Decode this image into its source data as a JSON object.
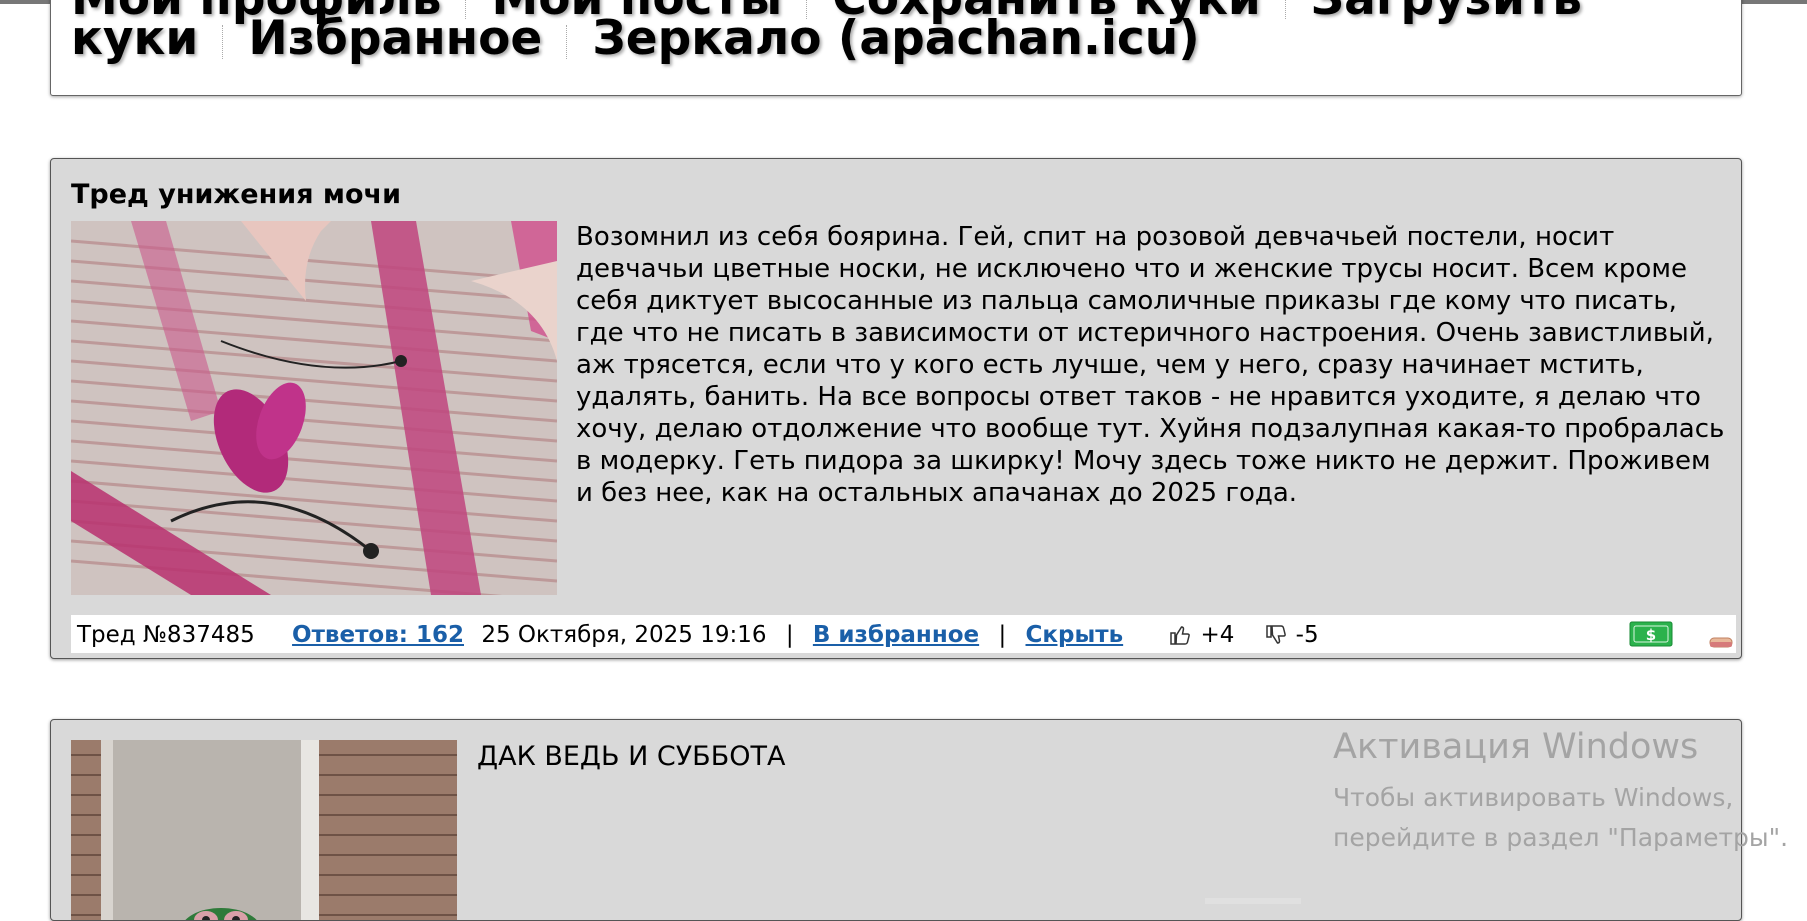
{
  "nav": {
    "row1": [
      "Мой профиль",
      "Мои посты",
      "Сохранить куки",
      "Загрузить"
    ],
    "row2": [
      "куки",
      "Избранное",
      "Зеркало (apachan.icu)"
    ]
  },
  "thread1": {
    "title": "Тред унижения мочи",
    "text": "Возомнил из себя боярина. Гей, спит на розовой девчачьей постели, носит девчачьи цветные носки, не исключено что и женские трусы носит. Всем кроме себя диктует высосанные из пальца самоличные приказы где кому что писать, где что не писать в зависимости от истеричного настроения. Очень завистливый, аж трясется, если что у кого есть лучше, чем у него, сразу начинает мстить, удалять, банить. На все вопросы ответ таков - не нравится уходите, я делаю что хочу, делаю отдолжение что вообще тут. Хуйня подзалупная какая-то пробралась в модерку. Геть пидора за шкирку! Мочу здесь тоже никто не держит. Проживем и без нее, как на остальных апачанах до 2025 года.",
    "footer": {
      "thread_number": "Тред №837485",
      "replies": "Ответов: 162",
      "date": "25 Октября, 2025 19:16",
      "pipe1": "|",
      "favorite": "В избранное",
      "pipe2": "|",
      "hide": "Скрыть",
      "likes": "+4",
      "dislikes": "-5"
    }
  },
  "thread2": {
    "text": "ДАК ВЕДЬ И СУББОТА"
  },
  "watermark": {
    "line1": "Активация Windows",
    "line2": "Чтобы активировать Windows,",
    "line3": "перейдите в раздел \"Параметры\"."
  },
  "icons": {
    "like": "thumbs-up-icon",
    "dislike": "thumbs-down-icon",
    "money": "money-icon",
    "eraser": "eraser-icon"
  },
  "colors": {
    "thread_bg": "#d9d9d9",
    "link": "#1a5fa8",
    "money_green": "#2bb24c"
  }
}
